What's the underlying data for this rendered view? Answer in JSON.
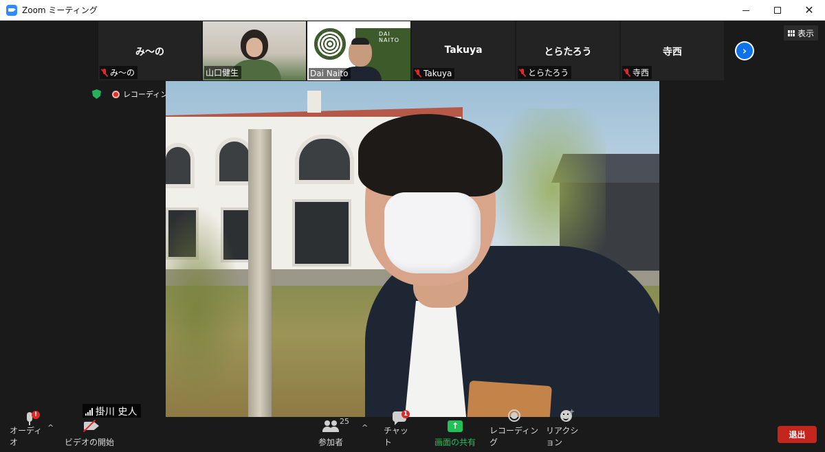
{
  "window": {
    "title": "Zoom ミーティング",
    "minimize_label": "",
    "maximize_label": "",
    "close_label": "✕"
  },
  "participants_strip": [
    {
      "display_name": "み〜の",
      "label": "み〜の",
      "muted": true,
      "video": false
    },
    {
      "display_name": "",
      "label": "山口健生",
      "muted": false,
      "video": true
    },
    {
      "display_name": "",
      "label": "Dai Naito",
      "muted": false,
      "video": true,
      "slide_text": "DAI NAITO"
    },
    {
      "display_name": "Takuya",
      "label": "Takuya",
      "muted": true,
      "video": false
    },
    {
      "display_name": "とらたろう",
      "label": "とらたろう",
      "muted": true,
      "video": false
    },
    {
      "display_name": "寺西",
      "label": "寺西",
      "muted": true,
      "video": false
    }
  ],
  "next_page_glyph": "›",
  "view_button": {
    "label": "表示",
    "icon": "grid-icon"
  },
  "indicators": {
    "security_icon": "shield-icon",
    "recording_label": "レコーディング中"
  },
  "main_video": {
    "speaker_name": "掛川 史人",
    "signal_icon": "signal-icon"
  },
  "toolbar": {
    "audio": {
      "label": "オーディオ",
      "badge": "!",
      "caret": "^"
    },
    "video": {
      "label": "ビデオの開始"
    },
    "participants": {
      "label": "参加者",
      "count": "25",
      "caret": "^"
    },
    "chat": {
      "label": "チャット",
      "badge": "1"
    },
    "share": {
      "label": "画面の共有",
      "glyph": "↑"
    },
    "record": {
      "label": "レコーディング"
    },
    "reactions": {
      "label": "リアクション",
      "plus": "+"
    },
    "leave": {
      "label": "退出"
    }
  },
  "colors": {
    "zoom_blue": "#0e72ed",
    "share_green": "#23c058",
    "leave_red": "#c4261d",
    "muted_red": "#e02828",
    "background": "#1a1a1a"
  }
}
